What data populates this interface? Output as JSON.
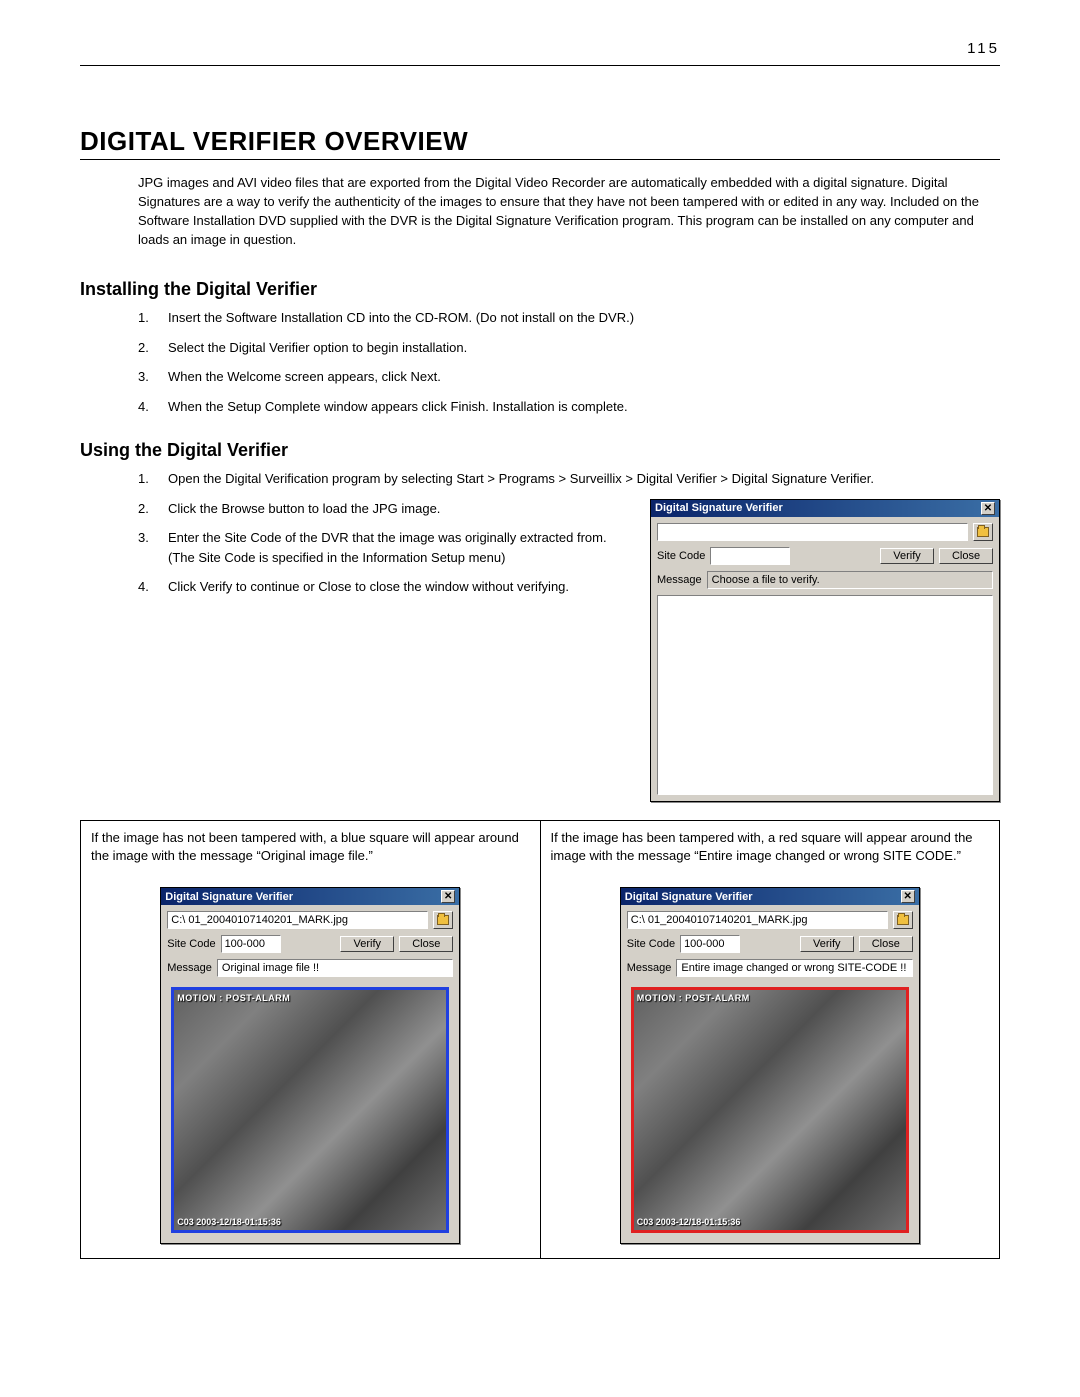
{
  "page_number": "115",
  "title": "DIGITAL VERIFIER OVERVIEW",
  "intro": "JPG images and AVI video files that are exported from the Digital Video Recorder are automatically embedded with a digital signature. Digital Signatures are a way to verify the authenticity of the images to ensure that they have not been tampered with or edited in any way.  Included on the Software Installation DVD supplied with the DVR is the Digital Signature Verification program. This program can be installed on any computer and loads an image in question.",
  "install": {
    "heading": "Installing the Digital Verifier",
    "steps": [
      "Insert the Software Installation CD into the CD-ROM.  (Do not install on the DVR.)",
      "Select the Digital Verifier option to begin installation.",
      "When the Welcome screen appears, click Next.",
      "When the Setup Complete window appears click Finish.  Installation is complete."
    ]
  },
  "using": {
    "heading": "Using the Digital Verifier",
    "steps": [
      "Open the Digital Verification program by selecting Start > Programs > Surveillix > Digital Verifier > Digital Signature Verifier.",
      "Click the Browse button to load the JPG image.",
      "Enter the Site Code of the DVR that the image was originally extracted from.  (The Site Code is specified in the Information Setup menu)",
      "Click Verify to continue or Close to close the window without verifying."
    ]
  },
  "dialog": {
    "title": "Digital Signature Verifier",
    "path_placeholder": "",
    "site_code_label": "Site Code",
    "verify_label": "Verify",
    "close_label": "Close",
    "message_label": "Message",
    "message_value": "Choose a file to verify."
  },
  "results": {
    "left_desc": "If the image has not been tampered with, a blue square will appear around the image with the message “Original image file.”",
    "right_desc": "If the image has been tampered with, a red square will appear around the image with the message “Entire image changed or wrong SITE CODE.”",
    "left_dialog": {
      "title": "Digital Signature Verifier",
      "path": "C:\\ 01_20040107140201_MARK.jpg",
      "site_code": "100-000",
      "message": "Original image file !!",
      "overlay_top": "MOTION : POST-ALARM",
      "overlay_bottom": "C03  2003-12/18-01:15:36"
    },
    "right_dialog": {
      "title": "Digital Signature Verifier",
      "path": "C:\\ 01_20040107140201_MARK.jpg",
      "site_code": "100-000",
      "message": "Entire image changed or wrong SITE-CODE !!",
      "overlay_top": "MOTION : POST-ALARM",
      "overlay_bottom": "C03  2003-12/18-01:15:36"
    }
  }
}
